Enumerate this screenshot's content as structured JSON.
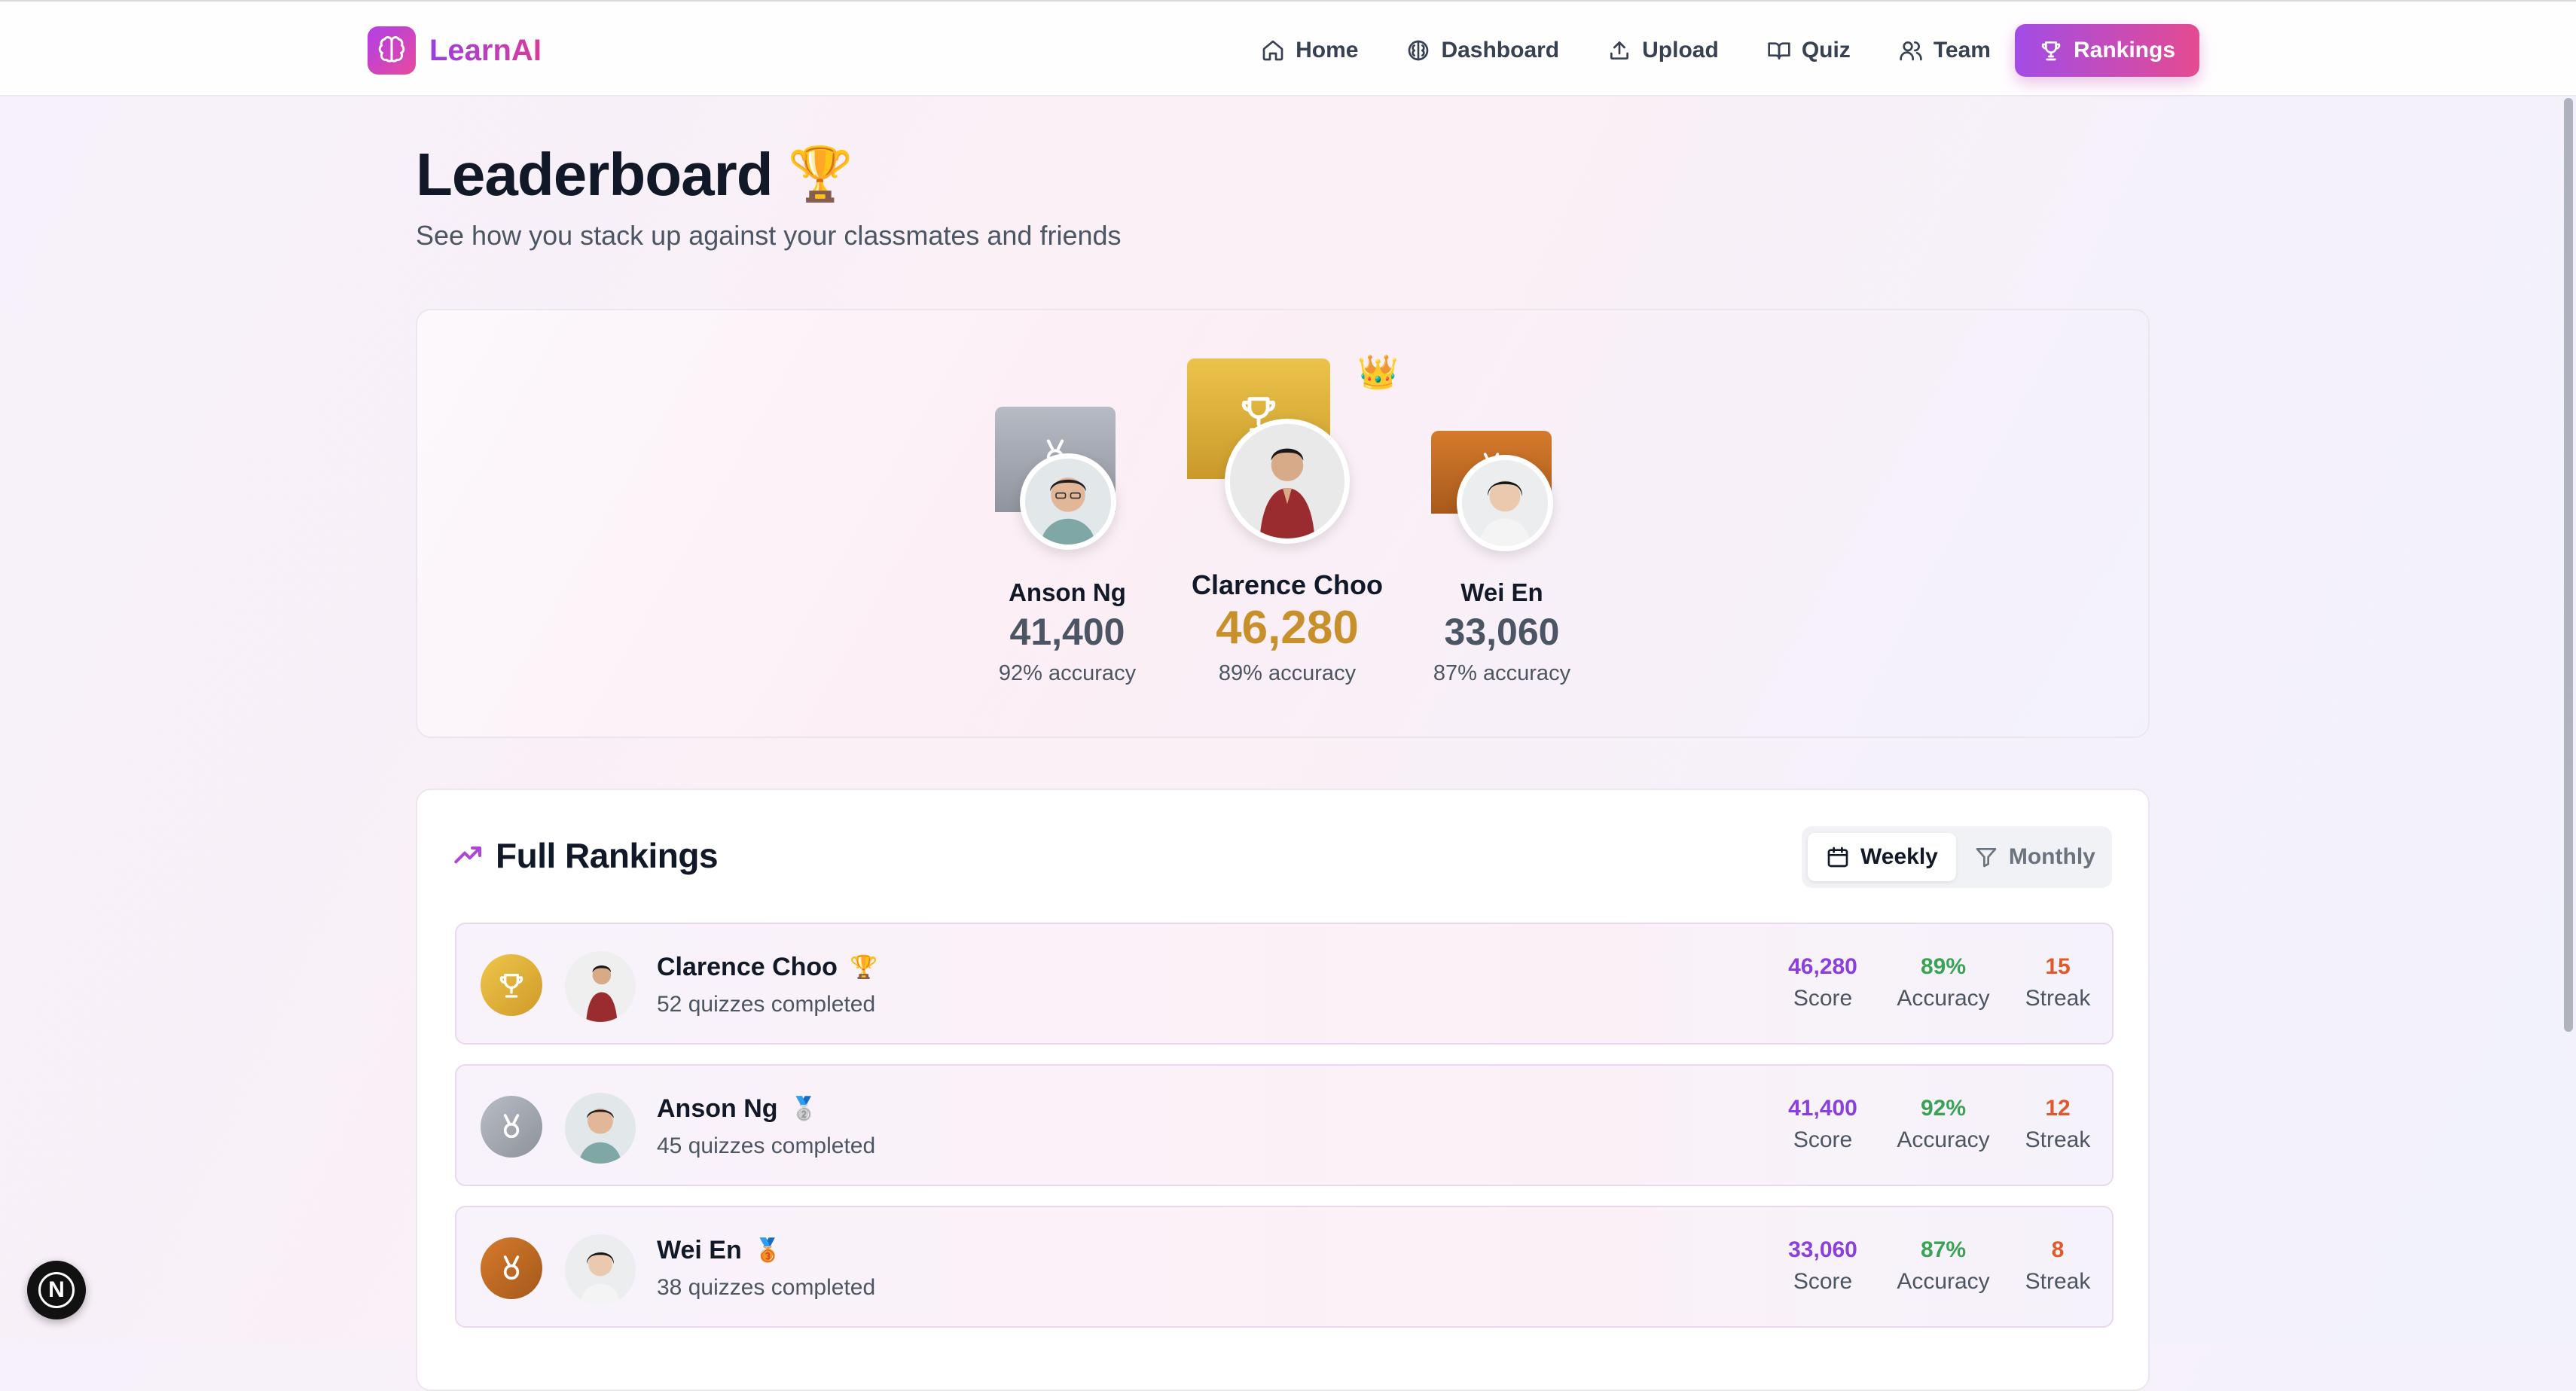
{
  "brand": {
    "name": "LearnAI"
  },
  "nav": {
    "items": [
      {
        "label": "Home",
        "icon": "home-icon"
      },
      {
        "label": "Dashboard",
        "icon": "brain-icon"
      },
      {
        "label": "Upload",
        "icon": "upload-icon"
      },
      {
        "label": "Quiz",
        "icon": "book-icon"
      },
      {
        "label": "Team",
        "icon": "users-icon"
      },
      {
        "label": "Rankings",
        "icon": "trophy-icon",
        "active": true
      }
    ]
  },
  "header": {
    "title": "Leaderboard",
    "title_emoji": "🏆",
    "subtitle": "See how you stack up against your classmates and friends"
  },
  "podium": {
    "crown": "👑",
    "first": {
      "name": "Clarence Choo",
      "score": "46,280",
      "accuracy": "89% accuracy"
    },
    "second": {
      "name": "Anson Ng",
      "score": "41,400",
      "accuracy": "92% accuracy"
    },
    "third": {
      "name": "Wei En",
      "score": "33,060",
      "accuracy": "87% accuracy"
    }
  },
  "rankings": {
    "title": "Full Rankings",
    "toggle": {
      "weekly": "Weekly",
      "monthly": "Monthly",
      "selected": "Weekly"
    },
    "stat_labels": {
      "score": "Score",
      "accuracy": "Accuracy",
      "streak": "Streak"
    },
    "rows": [
      {
        "name": "Clarence Choo",
        "badge": "🏆",
        "quizzes": "52 quizzes completed",
        "score": "46,280",
        "accuracy": "89%",
        "streak": "15"
      },
      {
        "name": "Anson Ng",
        "badge": "🥈",
        "quizzes": "45 quizzes completed",
        "score": "41,400",
        "accuracy": "92%",
        "streak": "12"
      },
      {
        "name": "Wei En",
        "badge": "🥉",
        "quizzes": "38 quizzes completed",
        "score": "33,060",
        "accuracy": "87%",
        "streak": "8"
      }
    ]
  },
  "fab": {
    "label": "N"
  },
  "colors": {
    "accent_purple": "#8b3fdc",
    "accent_pink": "#e44b91",
    "accuracy_green": "#3aa254",
    "streak_orange": "#e1592a",
    "gold": "#c8902a",
    "silver": "#9ca3af",
    "bronze": "#b8621e"
  }
}
